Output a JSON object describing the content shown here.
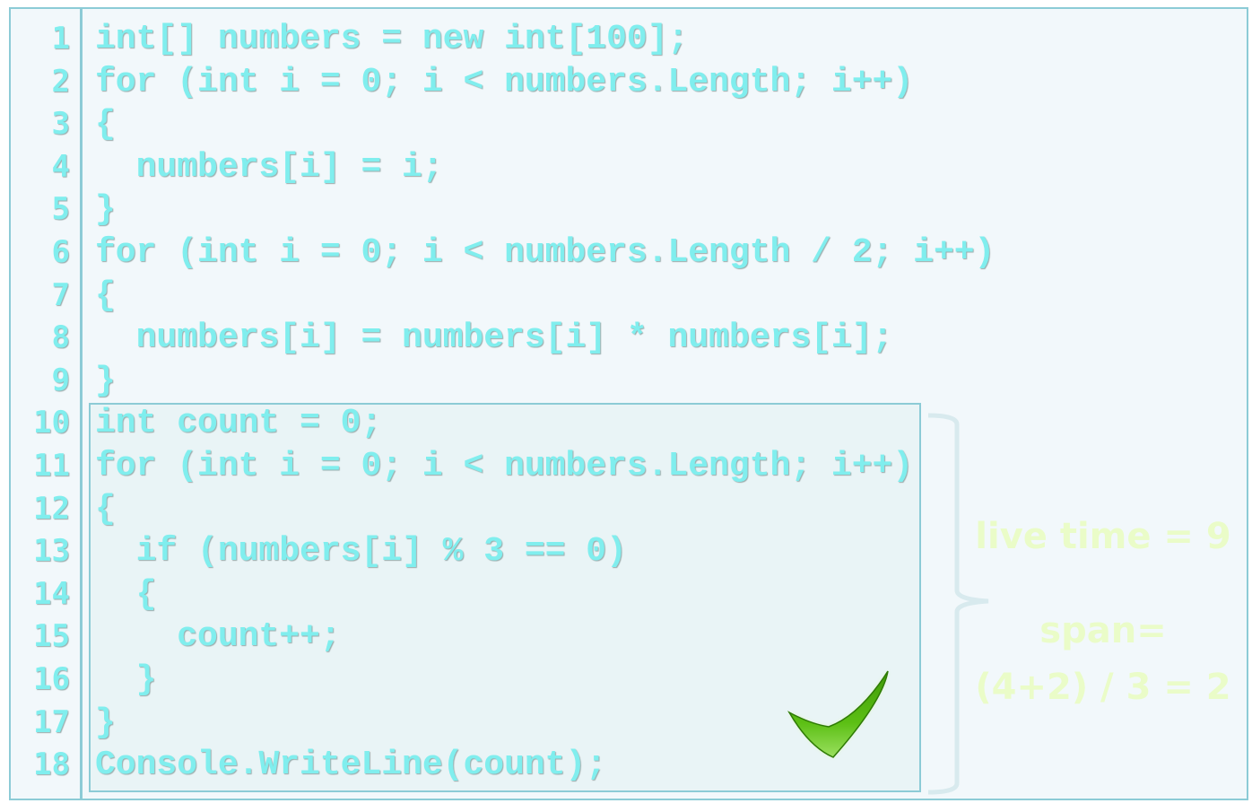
{
  "code_lines": [
    "int[] numbers = new int[100];",
    "for (int i = 0; i < numbers.Length; i++)",
    "{",
    "  numbers[i] = i;",
    "}",
    "for (int i = 0; i < numbers.Length / 2; i++)",
    "{",
    "  numbers[i] = numbers[i] * numbers[i];",
    "}",
    "int count = 0;",
    "for (int i = 0; i < numbers.Length; i++)",
    "{",
    "  if (numbers[i] % 3 == 0)",
    "  {",
    "    count++;",
    "  }",
    "}",
    "Console.WriteLine(count);"
  ],
  "line_numbers": [
    "1",
    "2",
    "3",
    "4",
    "5",
    "6",
    "7",
    "8",
    "9",
    "10",
    "11",
    "12",
    "13",
    "14",
    "15",
    "16",
    "17",
    "18"
  ],
  "annotation": {
    "live_time": "live time = 9",
    "span_label": "span=",
    "span_formula": "(4+2) / 3 = 2"
  },
  "icons": {
    "check": "checkmark-icon"
  },
  "colors": {
    "code": "#80eeee",
    "border": "#8ccbd6",
    "annotation": "#eafcc8",
    "check": "#4fb010"
  }
}
